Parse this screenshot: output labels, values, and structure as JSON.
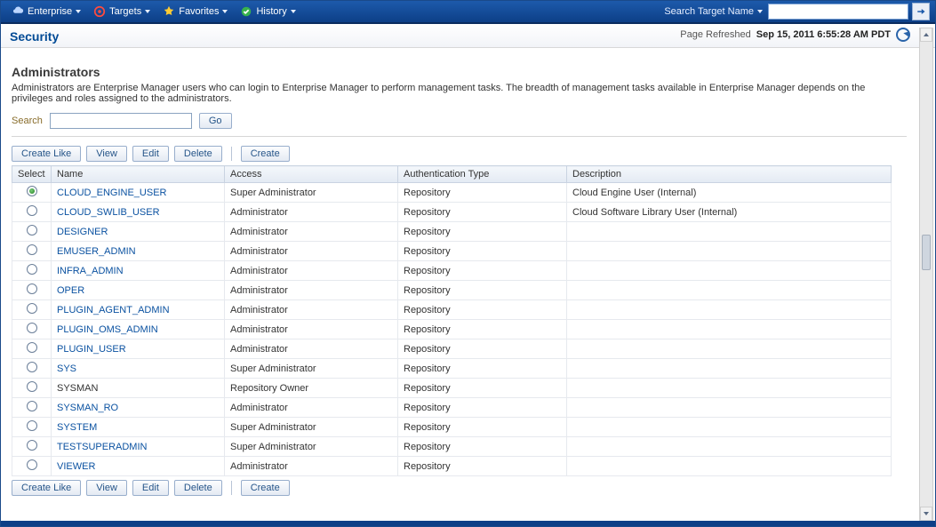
{
  "topnav": {
    "items": [
      {
        "label": "Enterprise"
      },
      {
        "label": "Targets"
      },
      {
        "label": "Favorites"
      },
      {
        "label": "History"
      }
    ],
    "search_label": "Search Target Name",
    "search_placeholder": ""
  },
  "page": {
    "title": "Security",
    "refresh_label": "Page Refreshed",
    "refresh_time": "Sep 15, 2011 6:55:28 AM PDT"
  },
  "admins": {
    "heading": "Administrators",
    "description": "Administrators are Enterprise Manager users who can login to Enterprise Manager to perform management tasks. The breadth of management tasks available in Enterprise Manager depends on the privileges and roles assigned to the administrators.",
    "search_label": "Search",
    "go_label": "Go",
    "toolbar": {
      "create_like": "Create Like",
      "view": "View",
      "edit": "Edit",
      "delete": "Delete",
      "create": "Create"
    },
    "columns": {
      "select": "Select",
      "name": "Name",
      "access": "Access",
      "auth": "Authentication Type",
      "desc": "Description"
    },
    "rows": [
      {
        "selected": true,
        "name": "CLOUD_ENGINE_USER",
        "link": true,
        "access": "Super Administrator",
        "auth": "Repository",
        "desc": "Cloud Engine User (Internal)"
      },
      {
        "selected": false,
        "name": "CLOUD_SWLIB_USER",
        "link": true,
        "access": "Administrator",
        "auth": "Repository",
        "desc": "Cloud Software Library User (Internal)"
      },
      {
        "selected": false,
        "name": "DESIGNER",
        "link": true,
        "access": "Administrator",
        "auth": "Repository",
        "desc": ""
      },
      {
        "selected": false,
        "name": "EMUSER_ADMIN",
        "link": true,
        "access": "Administrator",
        "auth": "Repository",
        "desc": ""
      },
      {
        "selected": false,
        "name": "INFRA_ADMIN",
        "link": true,
        "access": "Administrator",
        "auth": "Repository",
        "desc": ""
      },
      {
        "selected": false,
        "name": "OPER",
        "link": true,
        "access": "Administrator",
        "auth": "Repository",
        "desc": ""
      },
      {
        "selected": false,
        "name": "PLUGIN_AGENT_ADMIN",
        "link": true,
        "access": "Administrator",
        "auth": "Repository",
        "desc": ""
      },
      {
        "selected": false,
        "name": "PLUGIN_OMS_ADMIN",
        "link": true,
        "access": "Administrator",
        "auth": "Repository",
        "desc": ""
      },
      {
        "selected": false,
        "name": "PLUGIN_USER",
        "link": true,
        "access": "Administrator",
        "auth": "Repository",
        "desc": ""
      },
      {
        "selected": false,
        "name": "SYS",
        "link": true,
        "access": "Super Administrator",
        "auth": "Repository",
        "desc": ""
      },
      {
        "selected": false,
        "name": "SYSMAN",
        "link": false,
        "access": "Repository Owner",
        "auth": "Repository",
        "desc": ""
      },
      {
        "selected": false,
        "name": "SYSMAN_RO",
        "link": true,
        "access": "Administrator",
        "auth": "Repository",
        "desc": ""
      },
      {
        "selected": false,
        "name": "SYSTEM",
        "link": true,
        "access": "Super Administrator",
        "auth": "Repository",
        "desc": ""
      },
      {
        "selected": false,
        "name": "TESTSUPERADMIN",
        "link": true,
        "access": "Super Administrator",
        "auth": "Repository",
        "desc": ""
      },
      {
        "selected": false,
        "name": "VIEWER",
        "link": true,
        "access": "Administrator",
        "auth": "Repository",
        "desc": ""
      }
    ]
  }
}
